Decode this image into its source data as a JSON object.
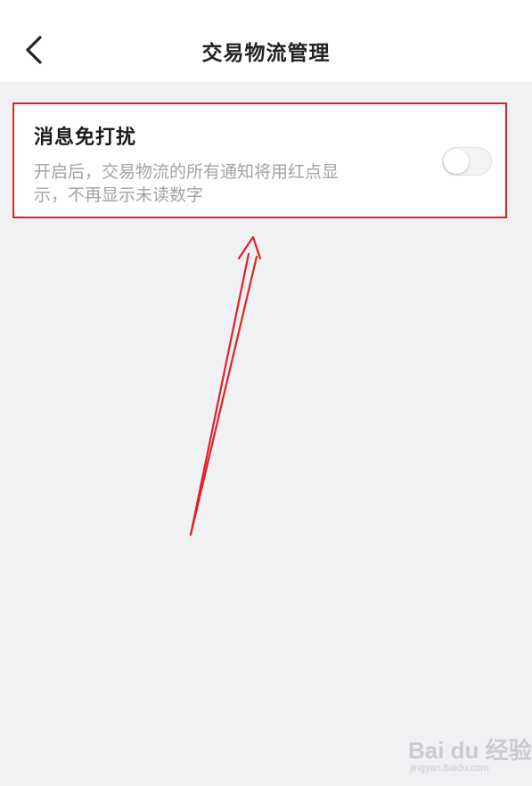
{
  "header": {
    "title": "交易物流管理",
    "back_icon": "chevron-left-icon"
  },
  "setting": {
    "title": "消息免打扰",
    "description_line1": "开启后，交易物流的所有通知将用红点显",
    "description_line2": "示，不再显示未读数字",
    "toggle_on": false
  },
  "annotation": {
    "highlight_color": "#e0222b"
  },
  "watermark": {
    "brand": "Bai du 经验",
    "url": "jingyan.baidu.com"
  }
}
